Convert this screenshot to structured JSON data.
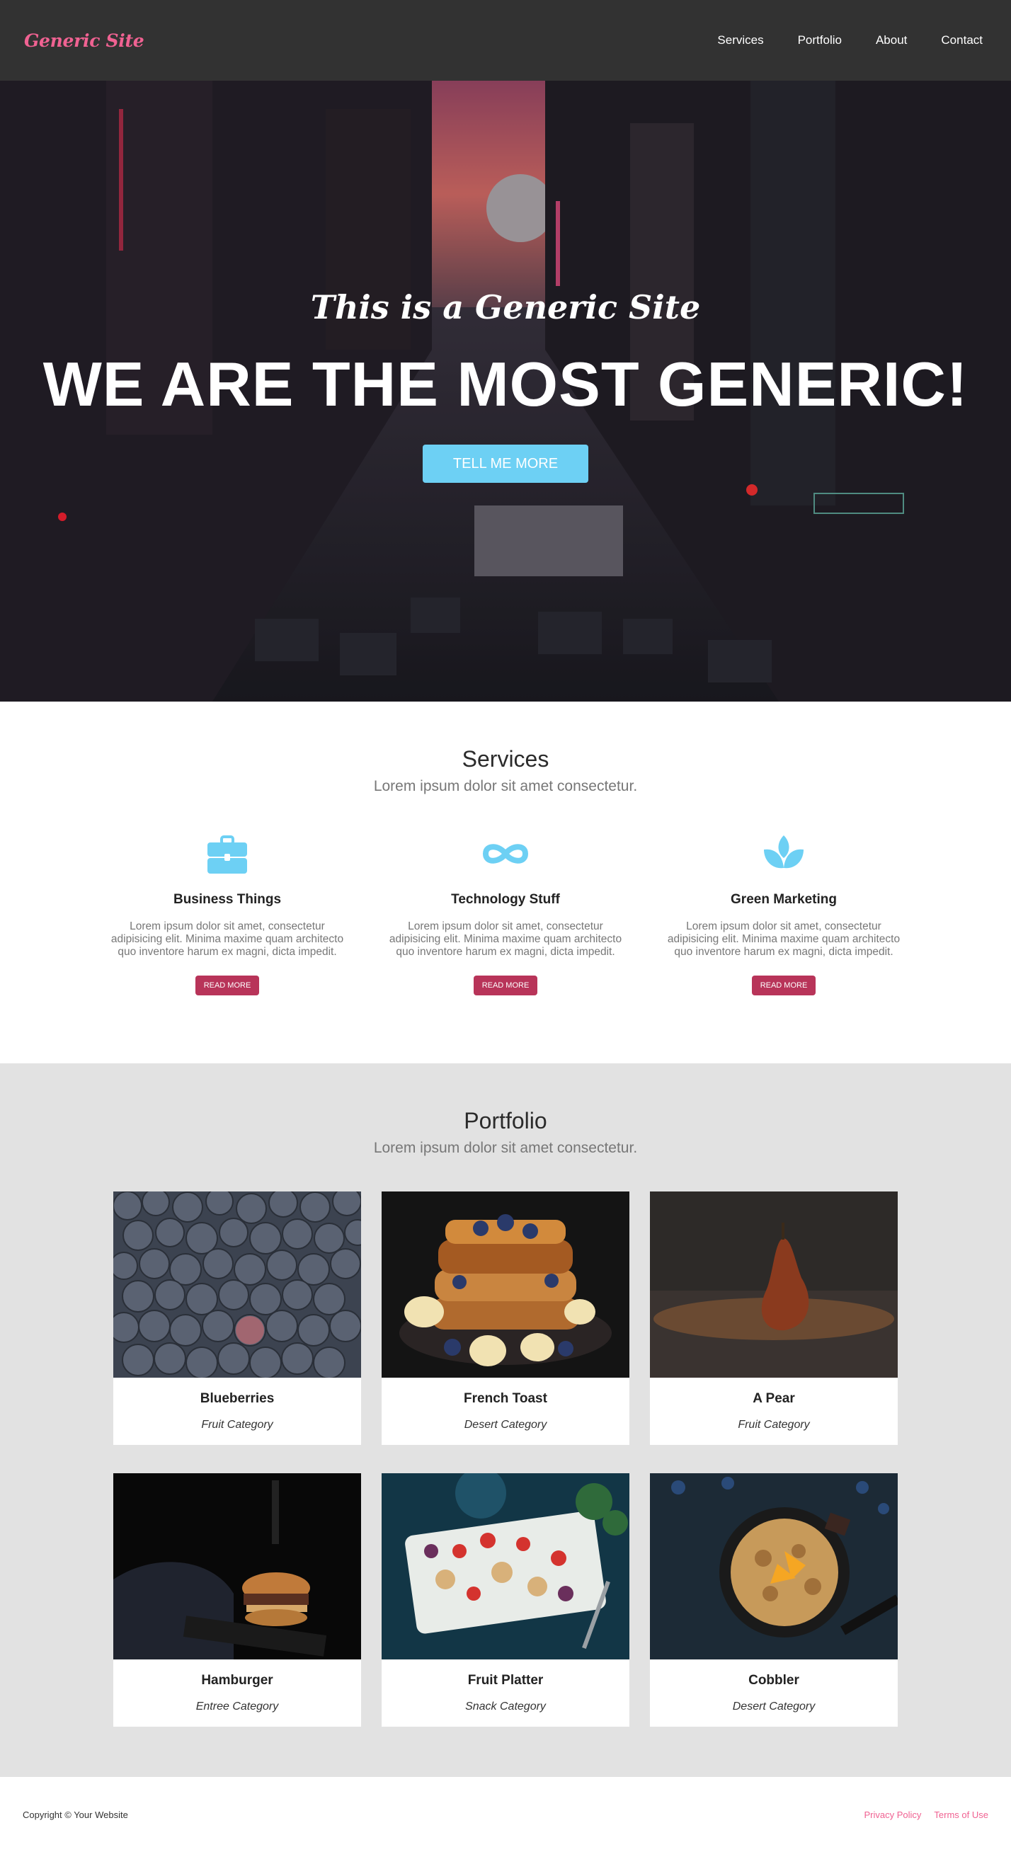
{
  "navbar": {
    "brand": "Generic Site",
    "links": [
      "Services",
      "Portfolio",
      "About",
      "Contact"
    ]
  },
  "hero": {
    "subtitle": "This is a Generic Site",
    "title": "WE ARE THE MOST GENERIC!",
    "button_label": "TELL ME MORE"
  },
  "services": {
    "title": "Services",
    "subtitle": "Lorem ipsum dolor sit amet consectetur.",
    "items": [
      {
        "icon": "briefcase-icon",
        "name": "Business Things",
        "text": "Lorem ipsum dolor sit amet, consectetur adipisicing elit. Minima maxime quam architecto quo inventore harum ex magni, dicta impedit.",
        "button": "READ MORE"
      },
      {
        "icon": "infinity-icon",
        "name": "Technology Stuff",
        "text": "Lorem ipsum dolor sit amet, consectetur adipisicing elit. Minima maxime quam architecto quo inventore harum ex magni, dicta impedit.",
        "button": "READ MORE"
      },
      {
        "icon": "leaf-icon",
        "name": "Green Marketing",
        "text": "Lorem ipsum dolor sit amet, consectetur adipisicing elit. Minima maxime quam architecto quo inventore harum ex magni, dicta impedit.",
        "button": "READ MORE"
      }
    ]
  },
  "portfolio": {
    "title": "Portfolio",
    "subtitle": "Lorem ipsum dolor sit amet consectetur.",
    "items": [
      {
        "name": "Blueberries",
        "category": "Fruit Category"
      },
      {
        "name": "French Toast",
        "category": "Desert Category"
      },
      {
        "name": "A Pear",
        "category": "Fruit Category"
      },
      {
        "name": "Hamburger",
        "category": "Entree Category"
      },
      {
        "name": "Fruit Platter",
        "category": "Snack Category"
      },
      {
        "name": "Cobbler",
        "category": "Desert Category"
      }
    ]
  },
  "footer": {
    "copyright": "Copyright © Your Website",
    "links": [
      "Privacy Policy",
      "Terms of Use"
    ]
  },
  "colors": {
    "navbar_bg": "#323232",
    "brand_pink": "#f06292",
    "accent_blue": "#6dd0f4",
    "button_crimson": "#b83459",
    "portfolio_bg": "#e2e2e2"
  }
}
